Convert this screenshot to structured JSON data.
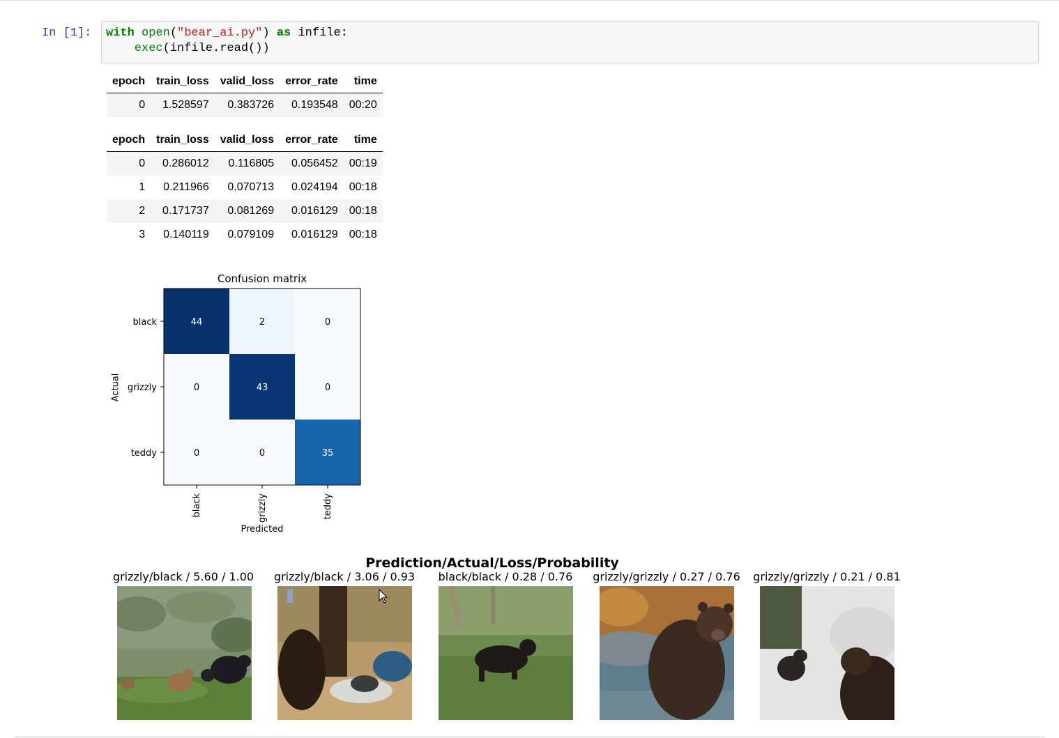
{
  "cell": {
    "prompt": "In [1]:",
    "code": {
      "kw_with": "with",
      "fn_open": "open",
      "paren_open": "(",
      "str_file": "\"bear_ai.py\"",
      "paren_close": ")",
      "kw_as": "as",
      "var_infile": "infile:",
      "indent": "    ",
      "fn_exec": "exec",
      "rest": "(infile.read())"
    }
  },
  "table1": {
    "headers": [
      "epoch",
      "train_loss",
      "valid_loss",
      "error_rate",
      "time"
    ],
    "rows": [
      [
        "0",
        "1.528597",
        "0.383726",
        "0.193548",
        "00:20"
      ]
    ]
  },
  "table2": {
    "headers": [
      "epoch",
      "train_loss",
      "valid_loss",
      "error_rate",
      "time"
    ],
    "rows": [
      [
        "0",
        "0.286012",
        "0.116805",
        "0.056452",
        "00:19"
      ],
      [
        "1",
        "0.211966",
        "0.070713",
        "0.024194",
        "00:18"
      ],
      [
        "2",
        "0.171737",
        "0.081269",
        "0.016129",
        "00:18"
      ],
      [
        "3",
        "0.140119",
        "0.079109",
        "0.016129",
        "00:18"
      ]
    ]
  },
  "chart_data": {
    "type": "heatmap",
    "title": "Confusion matrix",
    "xlabel": "Predicted",
    "ylabel": "Actual",
    "x_categories": [
      "black",
      "grizzly",
      "teddy"
    ],
    "y_categories": [
      "black",
      "grizzly",
      "teddy"
    ],
    "values": [
      [
        44,
        2,
        0
      ],
      [
        0,
        43,
        0
      ],
      [
        0,
        0,
        35
      ]
    ],
    "colormap": "Blues"
  },
  "top_losses": {
    "title": "Prediction/Actual/Loss/Probability",
    "items": [
      {
        "caption": "grizzly/black / 5.60 / 1.00"
      },
      {
        "caption": "grizzly/black / 3.06 / 0.93"
      },
      {
        "caption": "black/black / 0.28 / 0.76"
      },
      {
        "caption": "grizzly/grizzly / 0.27 / 0.76"
      },
      {
        "caption": "grizzly/grizzly / 0.21 / 0.81"
      }
    ]
  },
  "colors": {
    "prompt": "#303f9f",
    "keyword": "#008000",
    "string": "#ba2121",
    "cell_bg": "#f7f7f7"
  }
}
